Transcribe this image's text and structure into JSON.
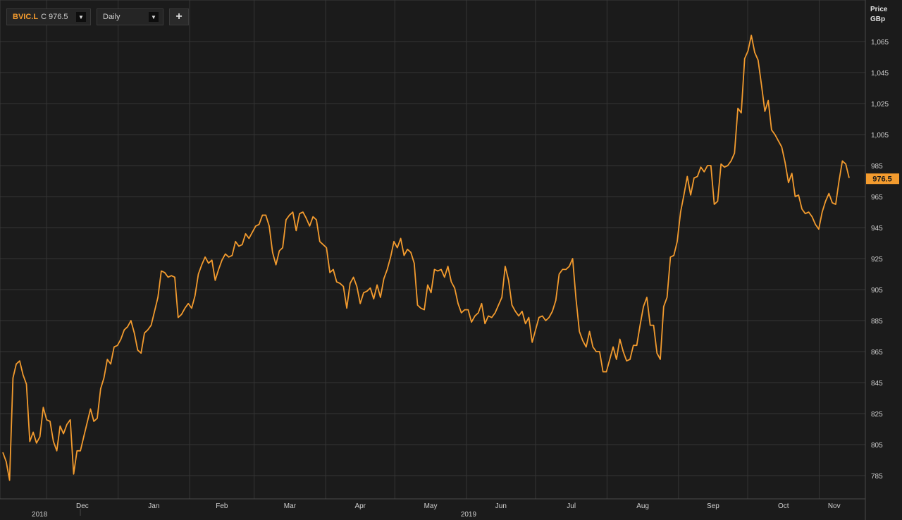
{
  "toolbar": {
    "ric": "BVIC.L",
    "close_prefix": "C",
    "close_value": "976.5",
    "period": "Daily",
    "add_symbol": "+",
    "dropdown_glyph": "▼"
  },
  "colors": {
    "line": "#f39b2e",
    "grid": "#353535",
    "background": "#1b1b1b",
    "axis_text": "#d0d0d0"
  },
  "chart_data": {
    "type": "line",
    "ylabel_line1": "Price",
    "ylabel_line2": "GBp",
    "ylim": [
      776,
      1072
    ],
    "yticks": [
      785,
      805,
      825,
      845,
      865,
      885,
      905,
      925,
      945,
      965,
      985,
      1005,
      1025,
      1045,
      1065
    ],
    "ytick_labels": [
      "785",
      "805",
      "825",
      "845",
      "865",
      "885",
      "905",
      "925",
      "945",
      "965",
      "985",
      "1,005",
      "1,025",
      "1,045",
      "1,065"
    ],
    "month_ticks": [
      "Dec",
      "Jan",
      "Feb",
      "Mar",
      "Apr",
      "May",
      "Jun",
      "Jul",
      "Aug",
      "Sep",
      "Oct",
      "Nov"
    ],
    "year_labels": [
      "2018",
      "2019"
    ],
    "last_value_label": "976.5",
    "x_start": "2018-11-12",
    "x_end": "2019-11-14",
    "series": [
      {
        "values": [
          800,
          794,
          782,
          848,
          857,
          859,
          850,
          844,
          807,
          813,
          806,
          810,
          829,
          821,
          820,
          807,
          801,
          817,
          812,
          818,
          821,
          786,
          801,
          801,
          810,
          819,
          828,
          820,
          822,
          841,
          848,
          860,
          857,
          868,
          869,
          873,
          879,
          881,
          885,
          877,
          866,
          864,
          877,
          879,
          882,
          891,
          900,
          917,
          916,
          913,
          914,
          913,
          887,
          889,
          893,
          896,
          893,
          901,
          915,
          921,
          926,
          922,
          924,
          911,
          918,
          924,
          928,
          926,
          927,
          936,
          933,
          934,
          941,
          938,
          942,
          946,
          947,
          953,
          953,
          946,
          929,
          921,
          930,
          932,
          950,
          953,
          955,
          943,
          954,
          955,
          951,
          946,
          952,
          950,
          936,
          934,
          932,
          916,
          918,
          910,
          909,
          907,
          893,
          909,
          913,
          907,
          896,
          903,
          904,
          906,
          899,
          908,
          900,
          912,
          918,
          926,
          936,
          932,
          938,
          927,
          931,
          929,
          922,
          895,
          893,
          892,
          908,
          903,
          918,
          917,
          918,
          913,
          920,
          910,
          906,
          896,
          890,
          892,
          892,
          884,
          888,
          890,
          896,
          883,
          888,
          887,
          890,
          895,
          900,
          920,
          911,
          895,
          891,
          888,
          891,
          883,
          887,
          871,
          879,
          887,
          888,
          885,
          887,
          891,
          898,
          915,
          918,
          918,
          920,
          925,
          899,
          878,
          872,
          868,
          878,
          868,
          865,
          865,
          852,
          852,
          860,
          868,
          860,
          873,
          865,
          859,
          860,
          869,
          869,
          882,
          894,
          900,
          882,
          882,
          864,
          860,
          894,
          900,
          926,
          927,
          936,
          955,
          966,
          978,
          966,
          977,
          978,
          984,
          981,
          985,
          985,
          960,
          962,
          986,
          984,
          985,
          988,
          993,
          1022,
          1019,
          1054,
          1059,
          1069,
          1058,
          1053,
          1037,
          1020,
          1027,
          1008,
          1005,
          1001,
          997,
          987,
          974,
          980,
          965,
          966,
          957,
          954,
          955,
          952,
          947,
          944,
          955,
          962,
          967,
          961,
          960,
          975,
          988,
          986,
          977
        ]
      }
    ]
  }
}
